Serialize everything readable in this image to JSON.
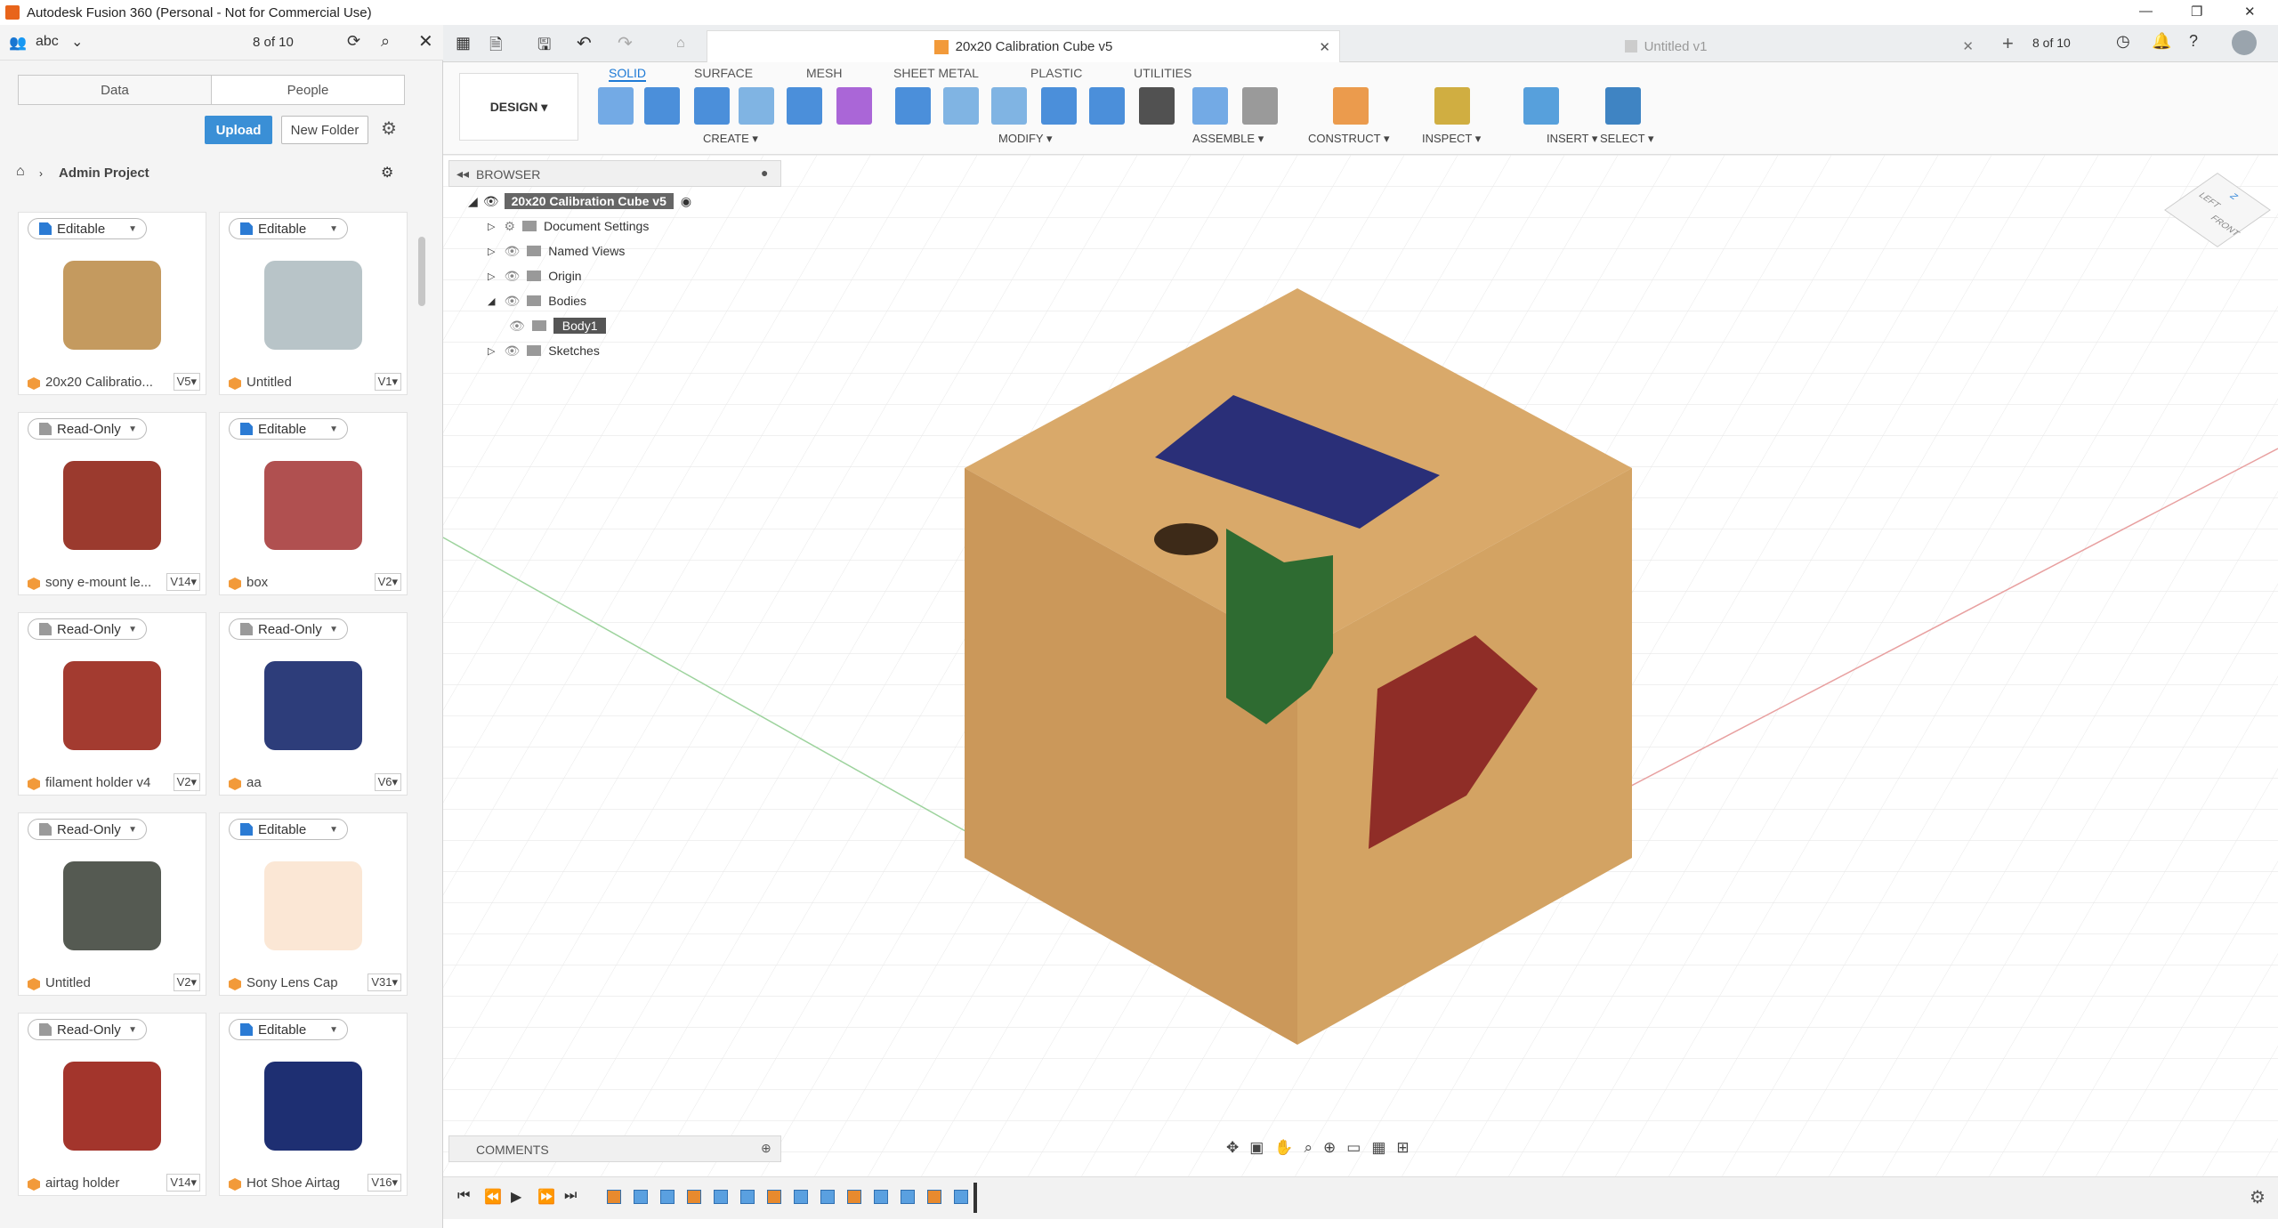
{
  "window": {
    "title": "Autodesk Fusion 360 (Personal - Not for Commercial Use)"
  },
  "data_panel": {
    "user": "abc",
    "page_counter": "8 of 10",
    "tabs": [
      "Data",
      "People"
    ],
    "upload": "Upload",
    "new_folder": "New Folder",
    "breadcrumb": "Admin Project",
    "cards": [
      {
        "badge": "Editable",
        "name": "20x20 Calibratio...",
        "version": "V5",
        "color": "#c49a5f"
      },
      {
        "badge": "Editable",
        "name": "Untitled",
        "version": "V1",
        "color": "#b8c4c8"
      },
      {
        "badge": "Read-Only",
        "name": "sony e-mount le...",
        "version": "V14",
        "color": "#9b3a2e"
      },
      {
        "badge": "Editable",
        "name": "box",
        "version": "V2",
        "color": "#b05050"
      },
      {
        "badge": "Read-Only",
        "name": "filament holder v4",
        "version": "V2",
        "color": "#a33b30"
      },
      {
        "badge": "Read-Only",
        "name": "aa",
        "version": "V6",
        "color": "#2d3d7a"
      },
      {
        "badge": "Read-Only",
        "name": "Untitled",
        "version": "V2",
        "color": "#555a52"
      },
      {
        "badge": "Editable",
        "name": "Sony Lens Cap",
        "version": "V31",
        "color": "#fbe7d5"
      },
      {
        "badge": "Read-Only",
        "name": "airtag holder",
        "version": "V14",
        "color": "#a3352c"
      },
      {
        "badge": "Editable",
        "name": "Hot Shoe Airtag",
        "version": "V16",
        "color": "#1e2f72"
      }
    ]
  },
  "tabs": {
    "active": "20x20 Calibration Cube v5",
    "other": "Untitled v1",
    "counter": "8 of 10"
  },
  "toolbar": {
    "workspace": "DESIGN",
    "tabs": [
      "SOLID",
      "SURFACE",
      "MESH",
      "SHEET METAL",
      "PLASTIC",
      "UTILITIES"
    ],
    "groups": [
      "CREATE",
      "MODIFY",
      "ASSEMBLE",
      "CONSTRUCT",
      "INSPECT",
      "INSERT",
      "SELECT"
    ]
  },
  "browser": {
    "title": "BROWSER",
    "root": "20x20 Calibration Cube v5",
    "items": [
      "Document Settings",
      "Named Views",
      "Origin",
      "Bodies",
      "Body1",
      "Sketches"
    ]
  },
  "comments": "COMMENTS",
  "viewcube": {
    "faces": [
      "LEFT",
      "FRONT",
      "Z"
    ]
  }
}
